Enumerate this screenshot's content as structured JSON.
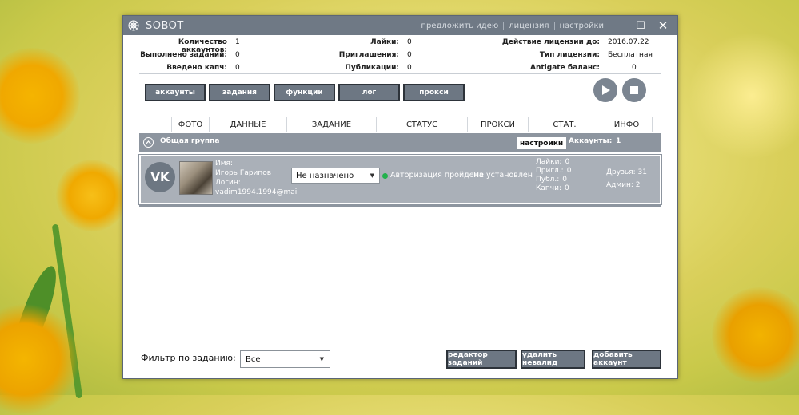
{
  "window": {
    "title": "SOBOT",
    "links": [
      "предложить идею",
      "лицензия",
      "настройки"
    ],
    "controls": {
      "minimize": "–",
      "maximize": "☐",
      "close": "✕"
    }
  },
  "stats": {
    "accounts_label": "Количество аккаунтов:",
    "accounts_value": "1",
    "tasks_done_label": "Выполнено заданий:",
    "tasks_done_value": "0",
    "captcha_label": "Введено капч:",
    "captcha_value": "0",
    "likes_label": "Лайки:",
    "likes_value": "0",
    "invites_label": "Приглашения:",
    "invites_value": "0",
    "posts_label": "Публикации:",
    "posts_value": "0",
    "license_until_label": "Действие лицензии до:",
    "license_until_value": "2016.07.22",
    "license_type_label": "Тип лицензии:",
    "license_type_value": "Бесплатная",
    "antigate_label": "Antigate баланс:",
    "antigate_value": "0"
  },
  "toolbar": {
    "tabs": [
      "аккаунты",
      "задания",
      "функции",
      "лог",
      "прокси"
    ]
  },
  "table": {
    "headers": [
      "ФОТО",
      "ДАННЫЕ",
      "ЗАДАНИЕ",
      "СТАТУС",
      "ПРОКСИ",
      "СТАТ.",
      "ИНФО"
    ],
    "group": {
      "name": "Общая группа",
      "settings_label": "настроики",
      "accounts_label": "Аккаунты:",
      "accounts_count": "1"
    },
    "rows": [
      {
        "avatar_text": "VK",
        "data_lines": [
          "Имя:",
          "Игорь Гарипов",
          "Логин:",
          "vadim1994.1994@mail"
        ],
        "task": "Не назначено",
        "status": "Авторизация пройдена",
        "status_color": "#22b14c",
        "proxy": "Не установлен",
        "stats": [
          {
            "label": "Лайки:",
            "value": "0"
          },
          {
            "label": "Пригл.:",
            "value": "0"
          },
          {
            "label": "Публ.:",
            "value": "0"
          },
          {
            "label": "Капчи:",
            "value": "0"
          }
        ],
        "info": [
          "Друзья: 31",
          "Админ: 2"
        ]
      }
    ]
  },
  "footer": {
    "filter_label": "Фильтр по заданию:",
    "filter_value": "Все",
    "buttons": [
      "редактор заданий",
      "удалить невалид",
      "добавить аккаунт"
    ]
  },
  "colors": {
    "titlebar": "#6f7985",
    "button": "#6d7783",
    "group_row": "#8d959f",
    "account_row": "#aab0b8",
    "status_ok": "#22b14c"
  }
}
